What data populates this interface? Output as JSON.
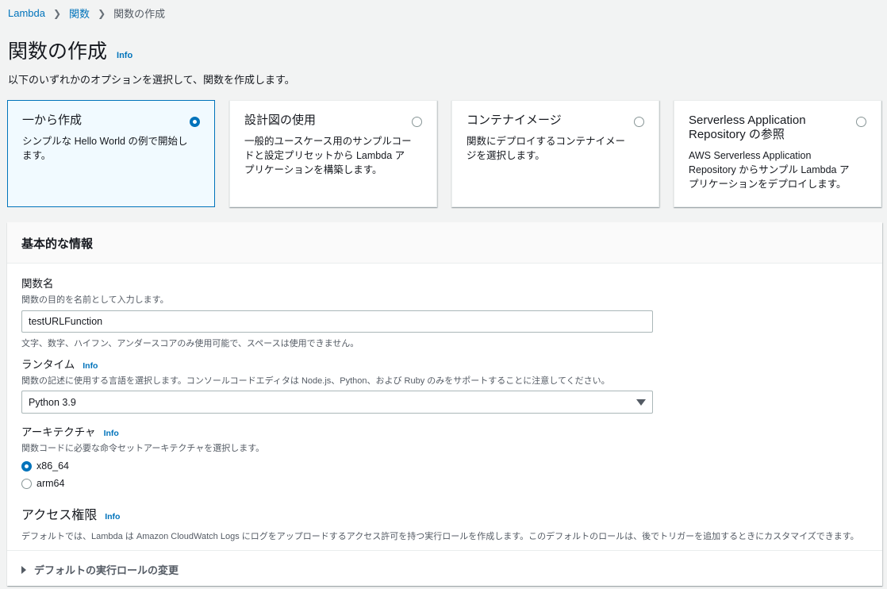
{
  "breadcrumb": {
    "root": "Lambda",
    "parent": "関数",
    "current": "関数の作成"
  },
  "page": {
    "title": "関数の作成",
    "info": "Info",
    "description": "以下のいずれかのオプションを選択して、関数を作成します。"
  },
  "options": [
    {
      "title": "一から作成",
      "desc": "シンプルな Hello World の例で開始します。",
      "selected": true
    },
    {
      "title": "設計図の使用",
      "desc": "一般的ユースケース用のサンプルコードと設定プリセットから Lambda アプリケーションを構築します。",
      "selected": false
    },
    {
      "title": "コンテナイメージ",
      "desc": "関数にデプロイするコンテナイメージを選択します。",
      "selected": false
    },
    {
      "title": "Serverless Application Repository の参照",
      "desc": "AWS Serverless Application Repository からサンプル Lambda アプリケーションをデプロイします。",
      "selected": false
    }
  ],
  "basic": {
    "title": "基本的な情報",
    "function_name": {
      "label": "関数名",
      "desc": "関数の目的を名前として入力します。",
      "value": "testURLFunction",
      "constraint": "文字、数字、ハイフン、アンダースコアのみ使用可能で、スペースは使用できません。"
    },
    "runtime": {
      "label": "ランタイム",
      "info": "Info",
      "desc": "関数の記述に使用する言語を選択します。コンソールコードエディタは Node.js、Python、および Ruby のみをサポートすることに注意してください。",
      "value": "Python 3.9"
    },
    "architecture": {
      "label": "アーキテクチャ",
      "info": "Info",
      "desc": "関数コードに必要な命令セットアーキテクチャを選択します。",
      "options": [
        "x86_64",
        "arm64"
      ],
      "selected": "x86_64"
    },
    "permissions": {
      "label": "アクセス権限",
      "info": "Info",
      "desc": "デフォルトでは、Lambda は Amazon CloudWatch Logs にログをアップロードするアクセス許可を持つ実行ロールを作成します。このデフォルトのロールは、後でトリガーを追加するときにカスタマイズできます。"
    },
    "expander": "デフォルトの実行ロールの変更"
  },
  "colors": {
    "accent": "#0073bb",
    "selected_tile_bg": "#f1faff",
    "page_bg": "#f2f3f3"
  }
}
